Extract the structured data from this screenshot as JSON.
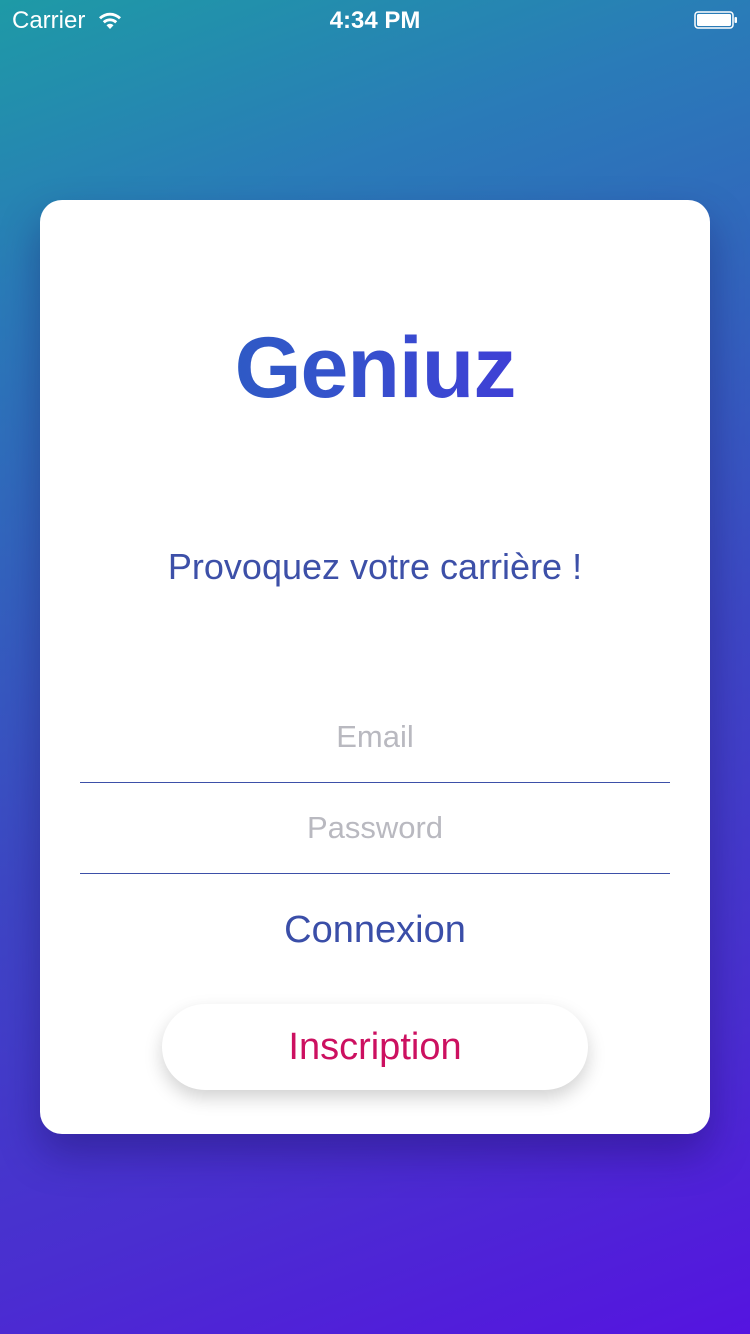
{
  "status_bar": {
    "carrier": "Carrier",
    "time": "4:34 PM",
    "wifi_icon": "wifi-icon",
    "battery_icon": "battery-icon"
  },
  "brand": {
    "logo_text": "Geniuz",
    "tagline": "Provoquez votre carrière !"
  },
  "login_form": {
    "email_placeholder": "Email",
    "email_value": "",
    "password_placeholder": "Password",
    "password_value": "",
    "login_label": "Connexion",
    "signup_label": "Inscription"
  },
  "colors": {
    "accent": "#3d50a8",
    "signup": "#cc1060",
    "gradient_start": "#1e9aa6",
    "gradient_end": "#5514e0"
  }
}
